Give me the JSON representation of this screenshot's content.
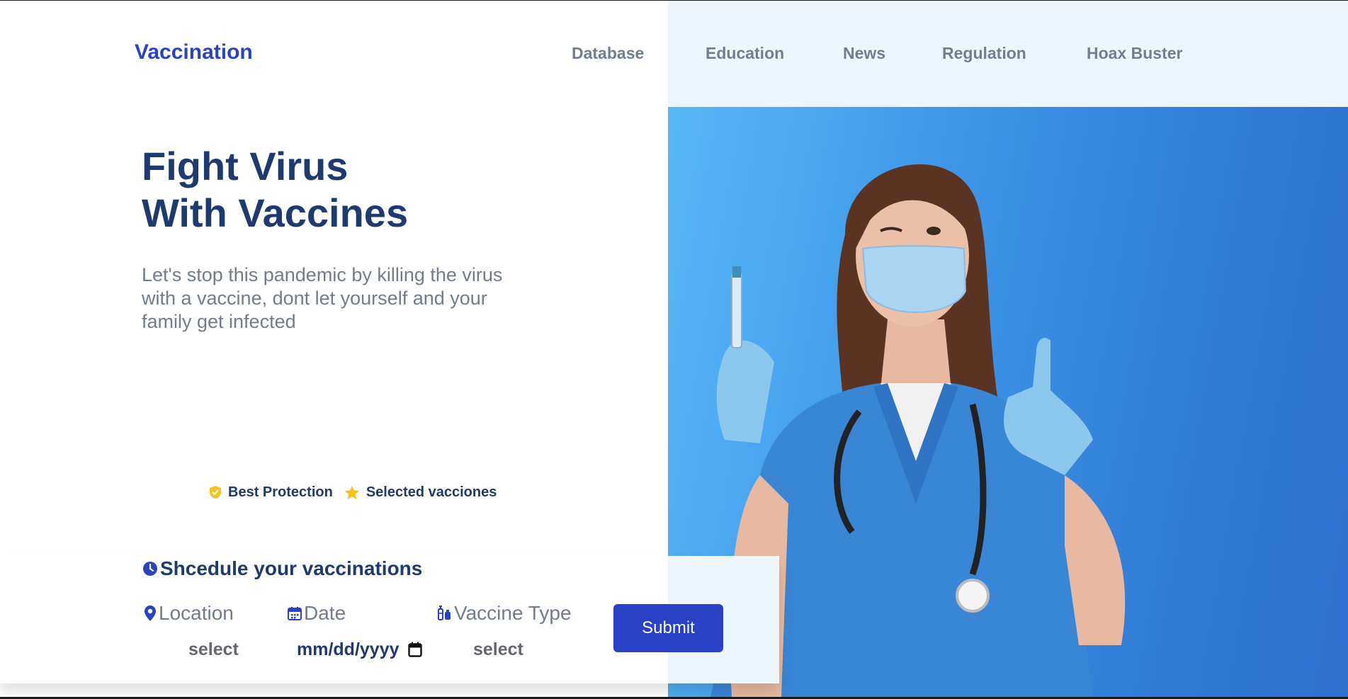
{
  "header": {
    "brand": "Vaccination",
    "nav": [
      "Database",
      "Education",
      "News",
      "Regulation",
      "Hoax Buster"
    ]
  },
  "hero": {
    "title_line1": "Fight Virus",
    "title_line2": "With Vaccines",
    "description": "Let's stop this pandemic by killing the virus with a vaccine, dont let yourself and your family get infected",
    "features": [
      {
        "label": "Best Protection",
        "icon": "shield-check-icon"
      },
      {
        "label": "Selected vacciones",
        "icon": "star-icon"
      }
    ]
  },
  "schedule": {
    "title": "Shcedule your vaccinations",
    "title_icon": "clock-icon",
    "location_label": "Location",
    "location_value": "select",
    "date_label": "Date",
    "date_value": "mm/dd/yyyy",
    "vaccine_label": "Vaccine Type",
    "vaccine_value": "select",
    "submit_label": "Submit"
  },
  "colors": {
    "brand": "#2a43c2",
    "heading": "#1e3a6e",
    "muted": "#717c8c",
    "nav_band": "#eef6fd",
    "hero_blue": "#3f98ea",
    "button": "#2841c5",
    "accent_gold": "#f6c21c"
  }
}
